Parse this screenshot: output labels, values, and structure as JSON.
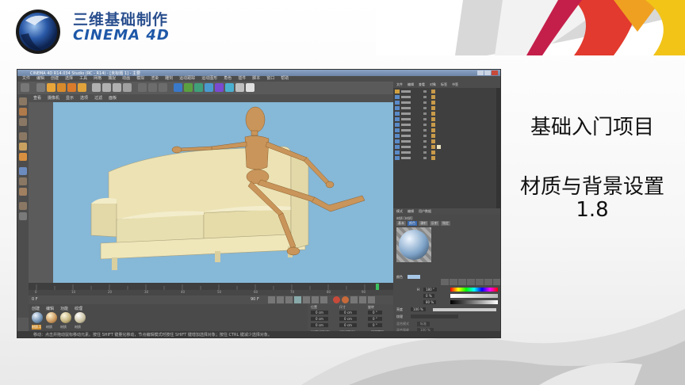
{
  "slide": {
    "brand_cn": "三维基础制作",
    "brand_en": "CINEMA 4D",
    "topic_1": "基础入门项目",
    "topic_2": "材质与背景设置",
    "topic_3": "1.8"
  },
  "app": {
    "title": "CINEMA 4D R14.034 Studio (RC - R14) - [未标题 1] - 主要",
    "menu": [
      "文件",
      "编辑",
      "创建",
      "选择",
      "工具",
      "网格",
      "捕捉",
      "动画",
      "模拟",
      "渲染",
      "雕刻",
      "运动跟踪",
      "运动图形",
      "角色",
      "插件",
      "脚本",
      "窗口",
      "帮助"
    ],
    "viewport_menu": [
      "查看",
      "摄像机",
      "显示",
      "选项",
      "过滤",
      "面板"
    ],
    "timeline_ticks": [
      "0",
      "5",
      "10",
      "15",
      "20",
      "25",
      "30",
      "35",
      "40",
      "45",
      "50",
      "55",
      "60",
      "65",
      "70",
      "75",
      "80",
      "85",
      "90"
    ],
    "frame_end": "90 F",
    "frame_start": "0 F",
    "material_menu": [
      "创建",
      "编辑",
      "功能",
      "纹理"
    ],
    "materials": [
      "材质.1",
      "材质",
      "材质",
      "材质"
    ],
    "coord_headers": [
      "位置",
      "尺寸",
      "旋转"
    ],
    "coord_x": [
      "0 cm",
      "0 cm",
      "0 °"
    ],
    "coord_y": [
      "0 cm",
      "0 cm",
      "0 °"
    ],
    "coord_z": [
      "0 cm",
      "0 cm",
      "0 °"
    ],
    "coord_buttons": [
      "对象 (相对)",
      "绝对尺寸",
      "应用"
    ],
    "attr_tabs": [
      "模式",
      "编辑",
      "用户数据"
    ],
    "attr_section": "材质 [材质]",
    "attr_subtabs": [
      "基本",
      "颜色",
      "漫射",
      "反射",
      "指定"
    ],
    "color_label": "颜色",
    "h_label": "H",
    "h_value": "180 °",
    "s_value": "0 %",
    "v_value": "80 %",
    "brightness_label": "亮度",
    "brightness_value": "100 %",
    "texture_label": "纹理",
    "mix_mode_label": "混合模式",
    "mix_mode_value": "标准",
    "mix_strength_label": "混合强度",
    "mix_strength_value": "100 %",
    "right_tabs": [
      "文件",
      "编辑",
      "查看",
      "对象",
      "标签",
      "书签"
    ],
    "status_text": "移动：点击并拖动鼠标移动元素。按住 SHIFT 键量化移动，节点编辑模式时按住 SHIFT 键增加选择对象；按住 CTRL 键减少选择对象。"
  },
  "colors": {
    "brand_blue": "#2a4f8e",
    "viewport_sky": "#86b8d8",
    "sofa": "#ede2b2",
    "mannequin": "#c9955a"
  }
}
